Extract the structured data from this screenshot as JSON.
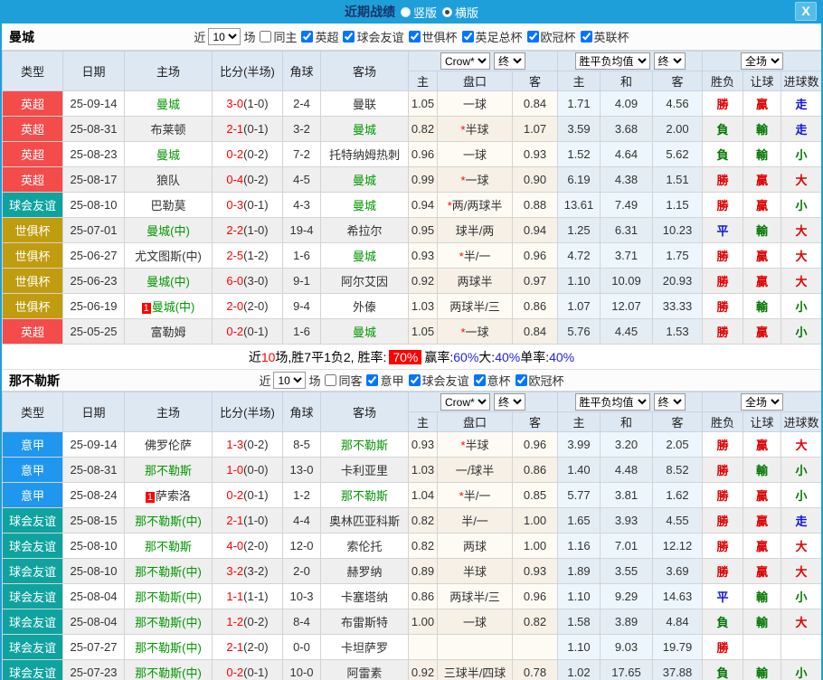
{
  "titlebar": {
    "title": "近期战绩",
    "vertical_label": "竖版",
    "horizontal_label": "横版",
    "selected": "横版",
    "close": "X"
  },
  "filters": {
    "near": "近",
    "count": "10",
    "games_suffix": "场"
  },
  "columns": {
    "type": "类型",
    "date": "日期",
    "home": "主场",
    "score": "比分(半场)",
    "corner": "角球",
    "away": "客场",
    "h": "主",
    "pan": "盘口",
    "a": "客",
    "m_h": "主",
    "m_d": "和",
    "m_a": "客",
    "wdl": "胜负",
    "rang": "让球",
    "goals": "进球数",
    "crown_select": "Crow*",
    "final_select": "终",
    "avg_select": "胜平负均值",
    "scope_select": "全场"
  },
  "colors": {
    "league": {
      "英超": "#f44b4b",
      "球会友谊": "#0fa3a0",
      "世俱杯": "#c09c0f",
      "意甲": "#1f97ef"
    }
  },
  "sections": [
    {
      "team": "曼城",
      "same_label": "同主",
      "same_checked": false,
      "leagues": [
        "英超",
        "球会友谊",
        "世俱杯",
        "英足总杯",
        "欧冠杯",
        "英联杯"
      ],
      "rows": [
        {
          "type": "英超",
          "date": "25-09-14",
          "home": {
            "name": "曼城",
            "green": true
          },
          "score": "3-0",
          "half": "(1-0)",
          "corner": "2-4",
          "away": {
            "name": "曼联",
            "green": false
          },
          "crown": {
            "h": "1.05",
            "star": false,
            "pan": "一球",
            "a": "0.84"
          },
          "avg": [
            "1.71",
            "4.09",
            "4.56"
          ],
          "res": [
            [
              "勝",
              "red"
            ],
            [
              "贏",
              "red"
            ],
            [
              "走",
              "blue"
            ]
          ]
        },
        {
          "type": "英超",
          "date": "25-08-31",
          "home": {
            "name": "布莱顿",
            "green": false
          },
          "score": "2-1",
          "half": "(0-1)",
          "corner": "3-2",
          "away": {
            "name": "曼城",
            "green": true
          },
          "crown": {
            "h": "0.82",
            "star": true,
            "pan": "半球",
            "a": "1.07"
          },
          "avg": [
            "3.59",
            "3.68",
            "2.00"
          ],
          "res": [
            [
              "負",
              "green"
            ],
            [
              "輸",
              "green"
            ],
            [
              "走",
              "blue"
            ]
          ]
        },
        {
          "type": "英超",
          "date": "25-08-23",
          "home": {
            "name": "曼城",
            "green": true
          },
          "score": "0-2",
          "half": "(0-2)",
          "corner": "7-2",
          "away": {
            "name": "托特纳姆热刺",
            "green": false
          },
          "crown": {
            "h": "0.96",
            "star": false,
            "pan": "一球",
            "a": "0.93"
          },
          "avg": [
            "1.52",
            "4.64",
            "5.62"
          ],
          "res": [
            [
              "負",
              "green"
            ],
            [
              "輸",
              "green"
            ],
            [
              "小",
              "green"
            ]
          ]
        },
        {
          "type": "英超",
          "date": "25-08-17",
          "home": {
            "name": "狼队",
            "green": false
          },
          "score": "0-4",
          "half": "(0-2)",
          "corner": "4-5",
          "away": {
            "name": "曼城",
            "green": true
          },
          "crown": {
            "h": "0.99",
            "star": true,
            "pan": "一球",
            "a": "0.90"
          },
          "avg": [
            "6.19",
            "4.38",
            "1.51"
          ],
          "res": [
            [
              "勝",
              "red"
            ],
            [
              "贏",
              "red"
            ],
            [
              "大",
              "red"
            ]
          ]
        },
        {
          "type": "球会友谊",
          "date": "25-08-10",
          "home": {
            "name": "巴勒莫",
            "green": false
          },
          "score": "0-3",
          "half": "(0-1)",
          "corner": "4-3",
          "away": {
            "name": "曼城",
            "green": true
          },
          "crown": {
            "h": "0.94",
            "star": true,
            "pan": "两/两球半",
            "a": "0.88"
          },
          "avg": [
            "13.61",
            "7.49",
            "1.15"
          ],
          "res": [
            [
              "勝",
              "red"
            ],
            [
              "贏",
              "red"
            ],
            [
              "小",
              "green"
            ]
          ]
        },
        {
          "type": "世俱杯",
          "date": "25-07-01",
          "home": {
            "name": "曼城(中)",
            "green": true
          },
          "score": "2-2",
          "half": "(1-0)",
          "corner": "19-4",
          "away": {
            "name": "希拉尔",
            "green": false
          },
          "crown": {
            "h": "0.95",
            "star": false,
            "pan": "球半/两",
            "a": "0.94"
          },
          "avg": [
            "1.25",
            "6.31",
            "10.23"
          ],
          "res": [
            [
              "平",
              "blue"
            ],
            [
              "輸",
              "green"
            ],
            [
              "大",
              "red"
            ]
          ]
        },
        {
          "type": "世俱杯",
          "date": "25-06-27",
          "home": {
            "name": "尤文图斯(中)",
            "green": false
          },
          "score": "2-5",
          "half": "(1-2)",
          "corner": "1-6",
          "away": {
            "name": "曼城",
            "green": true
          },
          "crown": {
            "h": "0.93",
            "star": true,
            "pan": "半/一",
            "a": "0.96"
          },
          "avg": [
            "4.72",
            "3.71",
            "1.75"
          ],
          "res": [
            [
              "勝",
              "red"
            ],
            [
              "贏",
              "red"
            ],
            [
              "大",
              "red"
            ]
          ]
        },
        {
          "type": "世俱杯",
          "date": "25-06-23",
          "home": {
            "name": "曼城(中)",
            "green": true
          },
          "score": "6-0",
          "half": "(3-0)",
          "corner": "9-1",
          "away": {
            "name": "阿尔艾因",
            "green": false
          },
          "crown": {
            "h": "0.92",
            "star": false,
            "pan": "两球半",
            "a": "0.97"
          },
          "avg": [
            "1.10",
            "10.09",
            "20.93"
          ],
          "res": [
            [
              "勝",
              "red"
            ],
            [
              "贏",
              "red"
            ],
            [
              "大",
              "red"
            ]
          ]
        },
        {
          "type": "世俱杯",
          "date": "25-06-19",
          "home": {
            "name": "曼城(中)",
            "green": true,
            "badge": "1"
          },
          "score": "2-0",
          "half": "(2-0)",
          "corner": "9-4",
          "away": {
            "name": "外傣",
            "green": false
          },
          "crown": {
            "h": "1.03",
            "star": false,
            "pan": "两球半/三",
            "a": "0.86"
          },
          "avg": [
            "1.07",
            "12.07",
            "33.33"
          ],
          "res": [
            [
              "勝",
              "red"
            ],
            [
              "輸",
              "green"
            ],
            [
              "小",
              "green"
            ]
          ]
        },
        {
          "type": "英超",
          "date": "25-05-25",
          "home": {
            "name": "富勒姆",
            "green": false
          },
          "score": "0-2",
          "half": "(0-1)",
          "corner": "1-6",
          "away": {
            "name": "曼城",
            "green": true
          },
          "crown": {
            "h": "1.05",
            "star": true,
            "pan": "一球",
            "a": "0.84"
          },
          "avg": [
            "5.76",
            "4.45",
            "1.53"
          ],
          "res": [
            [
              "勝",
              "red"
            ],
            [
              "贏",
              "red"
            ],
            [
              "小",
              "green"
            ]
          ]
        }
      ],
      "summary": {
        "segments": [
          {
            "t": "近"
          },
          {
            "t": "10",
            "c": "red"
          },
          {
            "t": "场,胜7平1负2, 胜率:"
          },
          {
            "t": "70%",
            "badge": true
          },
          {
            "t": " 赢率:"
          },
          {
            "t": "60%",
            "c": "blue"
          },
          {
            "t": " 大:"
          },
          {
            "t": "40%",
            "c": "blue"
          },
          {
            "t": " 单率:"
          },
          {
            "t": "40%",
            "c": "blue"
          }
        ]
      }
    },
    {
      "team": "那不勒斯",
      "same_label": "同客",
      "same_checked": false,
      "leagues": [
        "意甲",
        "球会友谊",
        "意杯",
        "欧冠杯"
      ],
      "rows": [
        {
          "type": "意甲",
          "date": "25-09-14",
          "home": {
            "name": "佛罗伦萨",
            "green": false
          },
          "score": "1-3",
          "half": "(0-2)",
          "corner": "8-5",
          "away": {
            "name": "那不勒斯",
            "green": true
          },
          "crown": {
            "h": "0.93",
            "star": true,
            "pan": "半球",
            "a": "0.96"
          },
          "avg": [
            "3.99",
            "3.20",
            "2.05"
          ],
          "res": [
            [
              "勝",
              "red"
            ],
            [
              "贏",
              "red"
            ],
            [
              "大",
              "red"
            ]
          ]
        },
        {
          "type": "意甲",
          "date": "25-08-31",
          "home": {
            "name": "那不勒斯",
            "green": true
          },
          "score": "1-0",
          "half": "(0-0)",
          "corner": "13-0",
          "away": {
            "name": "卡利亚里",
            "green": false
          },
          "crown": {
            "h": "1.03",
            "star": false,
            "pan": "一/球半",
            "a": "0.86"
          },
          "avg": [
            "1.40",
            "4.48",
            "8.52"
          ],
          "res": [
            [
              "勝",
              "red"
            ],
            [
              "輸",
              "green"
            ],
            [
              "小",
              "green"
            ]
          ]
        },
        {
          "type": "意甲",
          "date": "25-08-24",
          "home": {
            "name": "萨索洛",
            "green": false,
            "badge": "1"
          },
          "score": "0-2",
          "half": "(0-1)",
          "corner": "1-2",
          "away": {
            "name": "那不勒斯",
            "green": true
          },
          "crown": {
            "h": "1.04",
            "star": true,
            "pan": "半/一",
            "a": "0.85"
          },
          "avg": [
            "5.77",
            "3.81",
            "1.62"
          ],
          "res": [
            [
              "勝",
              "red"
            ],
            [
              "贏",
              "red"
            ],
            [
              "小",
              "green"
            ]
          ]
        },
        {
          "type": "球会友谊",
          "date": "25-08-15",
          "home": {
            "name": "那不勒斯(中)",
            "green": true
          },
          "score": "2-1",
          "half": "(1-0)",
          "corner": "4-4",
          "away": {
            "name": "奥林匹亚科斯",
            "green": false
          },
          "crown": {
            "h": "0.82",
            "star": false,
            "pan": "半/一",
            "a": "1.00"
          },
          "avg": [
            "1.65",
            "3.93",
            "4.55"
          ],
          "res": [
            [
              "勝",
              "red"
            ],
            [
              "贏",
              "red"
            ],
            [
              "走",
              "blue"
            ]
          ]
        },
        {
          "type": "球会友谊",
          "date": "25-08-10",
          "home": {
            "name": "那不勒斯",
            "green": true
          },
          "score": "4-0",
          "half": "(2-0)",
          "corner": "12-0",
          "away": {
            "name": "索伦托",
            "green": false
          },
          "crown": {
            "h": "0.82",
            "star": false,
            "pan": "两球",
            "a": "1.00"
          },
          "avg": [
            "1.16",
            "7.01",
            "12.12"
          ],
          "res": [
            [
              "勝",
              "red"
            ],
            [
              "贏",
              "red"
            ],
            [
              "大",
              "red"
            ]
          ]
        },
        {
          "type": "球会友谊",
          "date": "25-08-10",
          "home": {
            "name": "那不勒斯(中)",
            "green": true
          },
          "score": "3-2",
          "half": "(3-2)",
          "corner": "2-0",
          "away": {
            "name": "赫罗纳",
            "green": false
          },
          "crown": {
            "h": "0.89",
            "star": false,
            "pan": "半球",
            "a": "0.93"
          },
          "avg": [
            "1.89",
            "3.55",
            "3.69"
          ],
          "res": [
            [
              "勝",
              "red"
            ],
            [
              "贏",
              "red"
            ],
            [
              "大",
              "red"
            ]
          ]
        },
        {
          "type": "球会友谊",
          "date": "25-08-04",
          "home": {
            "name": "那不勒斯(中)",
            "green": true
          },
          "score": "1-1",
          "half": "(1-1)",
          "corner": "10-3",
          "away": {
            "name": "卡塞塔纳",
            "green": false
          },
          "crown": {
            "h": "0.86",
            "star": false,
            "pan": "两球半/三",
            "a": "0.96"
          },
          "avg": [
            "1.10",
            "9.29",
            "14.63"
          ],
          "res": [
            [
              "平",
              "blue"
            ],
            [
              "輸",
              "green"
            ],
            [
              "小",
              "green"
            ]
          ]
        },
        {
          "type": "球会友谊",
          "date": "25-08-04",
          "home": {
            "name": "那不勒斯(中)",
            "green": true
          },
          "score": "1-2",
          "half": "(0-2)",
          "corner": "8-4",
          "away": {
            "name": "布雷斯特",
            "green": false
          },
          "crown": {
            "h": "1.00",
            "star": false,
            "pan": "一球",
            "a": "0.82"
          },
          "avg": [
            "1.58",
            "3.89",
            "4.84"
          ],
          "res": [
            [
              "負",
              "green"
            ],
            [
              "輸",
              "green"
            ],
            [
              "大",
              "red"
            ]
          ]
        },
        {
          "type": "球会友谊",
          "date": "25-07-27",
          "home": {
            "name": "那不勒斯(中)",
            "green": true
          },
          "score": "2-1",
          "half": "(2-0)",
          "corner": "0-0",
          "away": {
            "name": "卡坦萨罗",
            "green": false
          },
          "crown": {
            "h": "",
            "star": false,
            "pan": "",
            "a": ""
          },
          "avg": [
            "1.10",
            "9.03",
            "19.79"
          ],
          "res": [
            [
              "勝",
              "red"
            ],
            [
              "",
              "red"
            ],
            [
              "",
              "red"
            ]
          ]
        },
        {
          "type": "球会友谊",
          "date": "25-07-23",
          "home": {
            "name": "那不勒斯(中)",
            "green": true
          },
          "score": "0-2",
          "half": "(0-1)",
          "corner": "10-0",
          "away": {
            "name": "阿雷素",
            "green": false
          },
          "crown": {
            "h": "0.92",
            "star": false,
            "pan": "三球半/四球",
            "a": "0.78"
          },
          "avg": [
            "1.02",
            "17.65",
            "37.88"
          ],
          "res": [
            [
              "負",
              "green"
            ],
            [
              "輸",
              "green"
            ],
            [
              "小",
              "green"
            ]
          ]
        }
      ],
      "summary": null
    }
  ]
}
